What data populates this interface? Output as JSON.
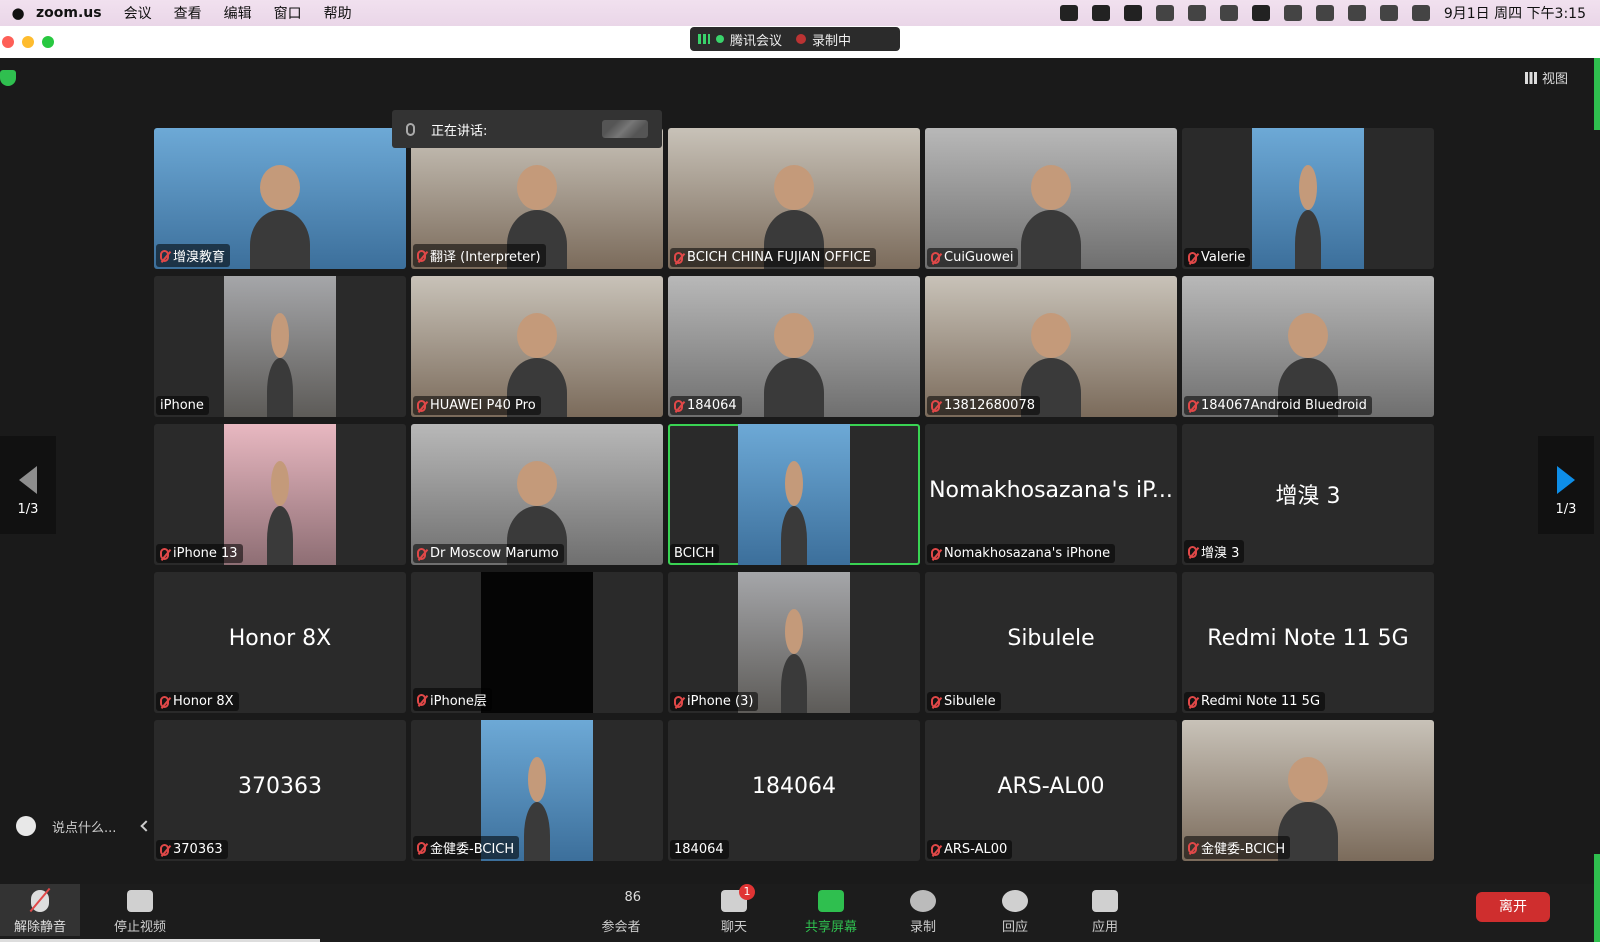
{
  "menubar": {
    "app_name": "zoom.us",
    "menus": [
      "会议",
      "查看",
      "编辑",
      "窗口",
      "帮助"
    ],
    "clock": "9月1日 周四 下午3:15"
  },
  "recording_pill": {
    "app_label": "腾讯会议",
    "status": "录制中"
  },
  "view_button": "视图",
  "speaking_label": "正在讲话:",
  "pager": {
    "left": "1/3",
    "right": "1/3"
  },
  "chat_placeholder": "说点什么...",
  "tiles": [
    {
      "name": "增溴教育",
      "muted": true,
      "kind": "video-blue"
    },
    {
      "name": "翻译 (Interpreter)",
      "muted": true,
      "kind": "video-room"
    },
    {
      "name": "BCICH CHINA FUJIAN OFFICE",
      "muted": true,
      "kind": "video-room"
    },
    {
      "name": "CuiGuowei",
      "muted": true,
      "kind": "video-grey"
    },
    {
      "name": "Valerie",
      "muted": true,
      "kind": "video-blue"
    },
    {
      "name": "iPhone",
      "muted": false,
      "kind": "video-skin"
    },
    {
      "name": "HUAWEI P40 Pro",
      "muted": true,
      "kind": "video-room"
    },
    {
      "name": "184064",
      "muted": true,
      "kind": "video-grey"
    },
    {
      "name": "13812680078",
      "muted": true,
      "kind": "video-room"
    },
    {
      "name": "184067Android Bluedroid",
      "muted": true,
      "kind": "video-grey"
    },
    {
      "name": "iPhone 13",
      "muted": true,
      "kind": "video-pink"
    },
    {
      "name": "Dr Moscow Marumo",
      "muted": true,
      "kind": "video-grey"
    },
    {
      "name": "BCICH",
      "muted": false,
      "kind": "video-blue",
      "active": true
    },
    {
      "name": "Nomakhosazana's iPhone",
      "muted": true,
      "big": "Nomakhosazana's iP..."
    },
    {
      "name": "增溴 3",
      "muted": true,
      "big": "增溴 3"
    },
    {
      "name": "Honor 8X",
      "muted": true,
      "big": "Honor 8X"
    },
    {
      "name": "iPhone层",
      "muted": true,
      "kind": "video-dark"
    },
    {
      "name": "iPhone (3)",
      "muted": true,
      "kind": "video-skin"
    },
    {
      "name": "Sibulele",
      "muted": true,
      "big": "Sibulele"
    },
    {
      "name": "Redmi Note 11 5G",
      "muted": true,
      "big": "Redmi Note 11 5G"
    },
    {
      "name": "370363",
      "muted": true,
      "big": "370363"
    },
    {
      "name": "金健委-BCICH",
      "muted": true,
      "kind": "video-blue"
    },
    {
      "name": "184064",
      "muted": false,
      "big": "184064"
    },
    {
      "name": "ARS-AL00",
      "muted": true,
      "big": "ARS-AL00"
    },
    {
      "name": "金健委-BCICH",
      "muted": true,
      "kind": "video-room"
    }
  ],
  "toolbar": {
    "unmute": "解除静音",
    "stop_video": "停止视频",
    "participants": "参会者",
    "participant_count": "86",
    "chat": "聊天",
    "chat_badge": "1",
    "share": "共享屏幕",
    "record": "录制",
    "reactions": "回应",
    "apps": "应用",
    "leave": "离开"
  },
  "colors": {
    "active_speaker": "#39d353",
    "leave": "#cf2e2e",
    "share": "#2fbf4f",
    "muted": "#e04848"
  }
}
